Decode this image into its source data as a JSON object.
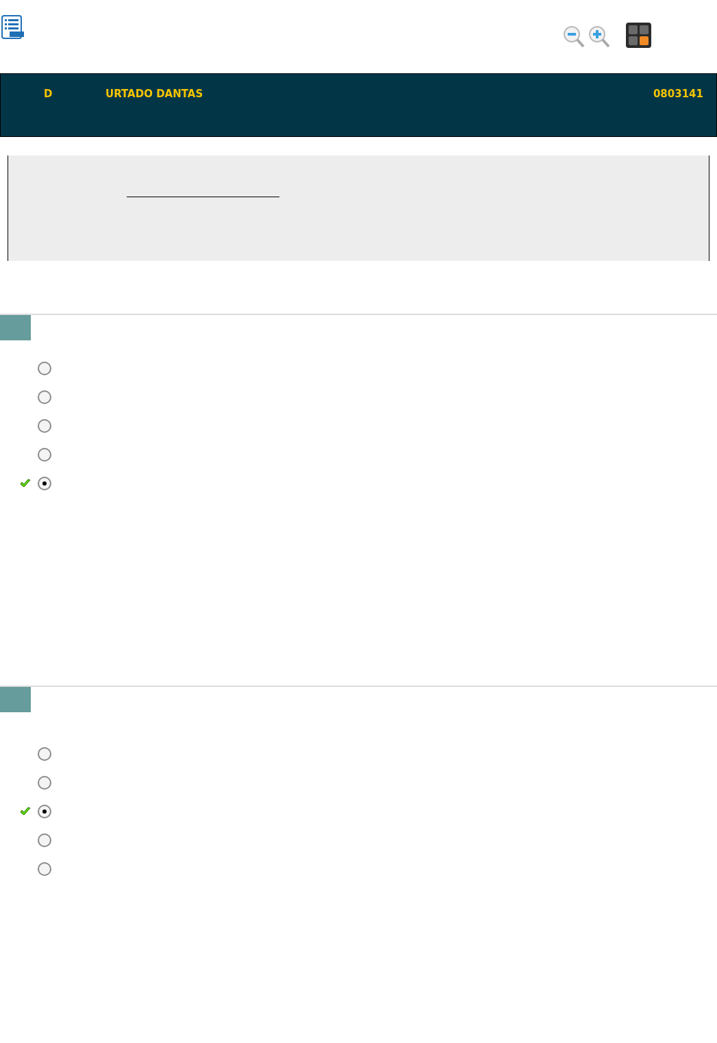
{
  "header": {
    "initial": "D",
    "name": "URTADO DANTAS",
    "code": "0803141"
  },
  "questions": [
    {
      "options": [
        {
          "selected": false,
          "marked_correct": false
        },
        {
          "selected": false,
          "marked_correct": false
        },
        {
          "selected": false,
          "marked_correct": false
        },
        {
          "selected": false,
          "marked_correct": false
        },
        {
          "selected": true,
          "marked_correct": true
        }
      ]
    },
    {
      "options": [
        {
          "selected": false,
          "marked_correct": false
        },
        {
          "selected": false,
          "marked_correct": false
        },
        {
          "selected": true,
          "marked_correct": true
        },
        {
          "selected": false,
          "marked_correct": false
        },
        {
          "selected": false,
          "marked_correct": false
        }
      ]
    }
  ]
}
